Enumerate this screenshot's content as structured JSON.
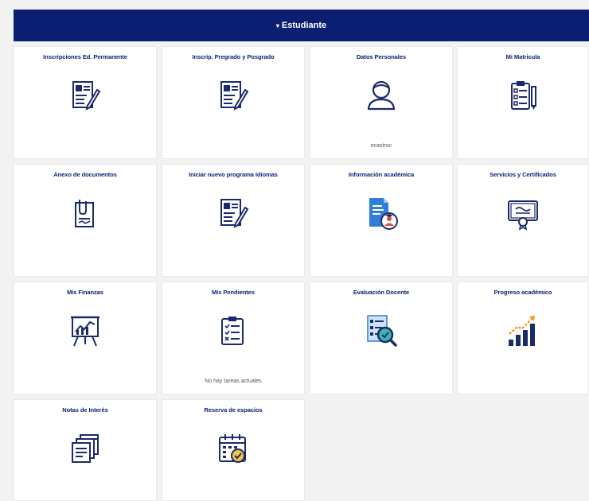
{
  "header": {
    "caret": "▾",
    "title": "Estudiante"
  },
  "colors": {
    "header_bg": "#0a1f72",
    "icon_navy": "#1b2a6b",
    "icon_blue": "#2f7fd8",
    "accent_orange": "#f39a1e",
    "accent_red": "#e54a3a"
  },
  "tiles": [
    {
      "title": "Inscripciones Ed. Permanente",
      "icon": "id-form-icon",
      "footer": ""
    },
    {
      "title": "Inscrip. Pregrado y Posgrado",
      "icon": "id-form-icon",
      "footer": ""
    },
    {
      "title": "Datos Personales",
      "icon": "user-icon",
      "footer": "ecastroc"
    },
    {
      "title": "Mi Matricula",
      "icon": "clipboard-list-icon",
      "footer": ""
    },
    {
      "title": "Anexo de documentos",
      "icon": "attach-document-icon",
      "footer": ""
    },
    {
      "title": "Iniciar nuevo programa Idiomas",
      "icon": "id-form-icon",
      "footer": ""
    },
    {
      "title": "Información académica",
      "icon": "academic-info-icon",
      "footer": ""
    },
    {
      "title": "Servicios y Certificados",
      "icon": "certificate-icon",
      "footer": ""
    },
    {
      "title": "Mis Finanzas",
      "icon": "presentation-board-icon",
      "footer": ""
    },
    {
      "title": "Mis Pendientes",
      "icon": "checklist-icon",
      "footer": "No hay tareas actuales"
    },
    {
      "title": "Evaluación Docente",
      "icon": "evaluation-search-icon",
      "footer": ""
    },
    {
      "title": "Progreso académico",
      "icon": "growth-chart-icon",
      "footer": ""
    },
    {
      "title": "Notas de Interés",
      "icon": "notes-stack-icon",
      "footer": ""
    },
    {
      "title": "Reserva de espacios",
      "icon": "calendar-check-icon",
      "footer": ""
    }
  ]
}
